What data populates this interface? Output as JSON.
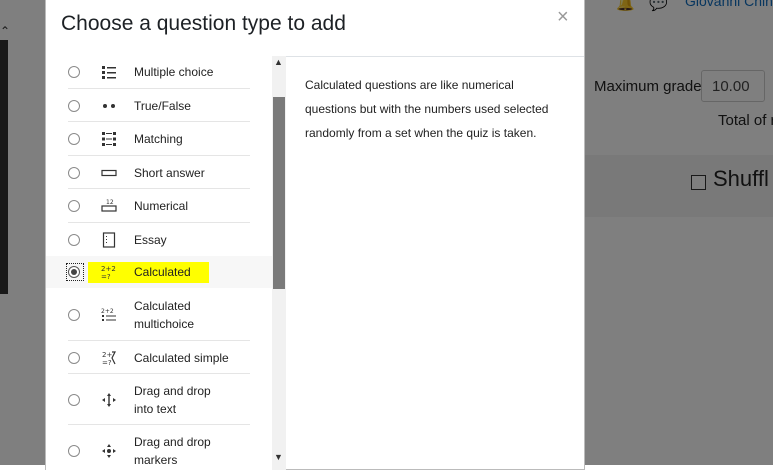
{
  "background": {
    "user_name": "Giovanni Chin",
    "max_grade_label": "Maximum grade",
    "max_grade_value": "10.00",
    "total_label": "Total of r",
    "shuffle_label": "Shuffl"
  },
  "modal": {
    "title": "Choose a question type to add",
    "close": "×",
    "description": "Calculated questions are like numerical questions but with the numbers used selected randomly from a set when the quiz is taken.",
    "options": [
      {
        "label_lines": [
          "Multiple choice"
        ],
        "icon": "multiple-choice-icon",
        "selected": false
      },
      {
        "label_lines": [
          "True/False"
        ],
        "icon": "true-false-icon",
        "selected": false
      },
      {
        "label_lines": [
          "Matching"
        ],
        "icon": "matching-icon",
        "selected": false
      },
      {
        "label_lines": [
          "Short answer"
        ],
        "icon": "short-answer-icon",
        "selected": false
      },
      {
        "label_lines": [
          "Numerical"
        ],
        "icon": "numerical-icon",
        "selected": false
      },
      {
        "label_lines": [
          "Essay"
        ],
        "icon": "essay-icon",
        "selected": false
      },
      {
        "label_lines": [
          "Calculated"
        ],
        "icon": "calculated-icon",
        "selected": true
      },
      {
        "label_lines": [
          "Calculated",
          "multichoice"
        ],
        "icon": "calculated-multichoice-icon",
        "selected": false
      },
      {
        "label_lines": [
          "Calculated simple"
        ],
        "icon": "calculated-simple-icon",
        "selected": false
      },
      {
        "label_lines": [
          "Drag and drop",
          "into text"
        ],
        "icon": "drag-drop-text-icon",
        "selected": false
      },
      {
        "label_lines": [
          "Drag and drop",
          "markers"
        ],
        "icon": "drag-drop-markers-icon",
        "selected": false
      }
    ]
  },
  "colors": {
    "highlight": "#ffff00",
    "link": "#0f6cbf"
  }
}
